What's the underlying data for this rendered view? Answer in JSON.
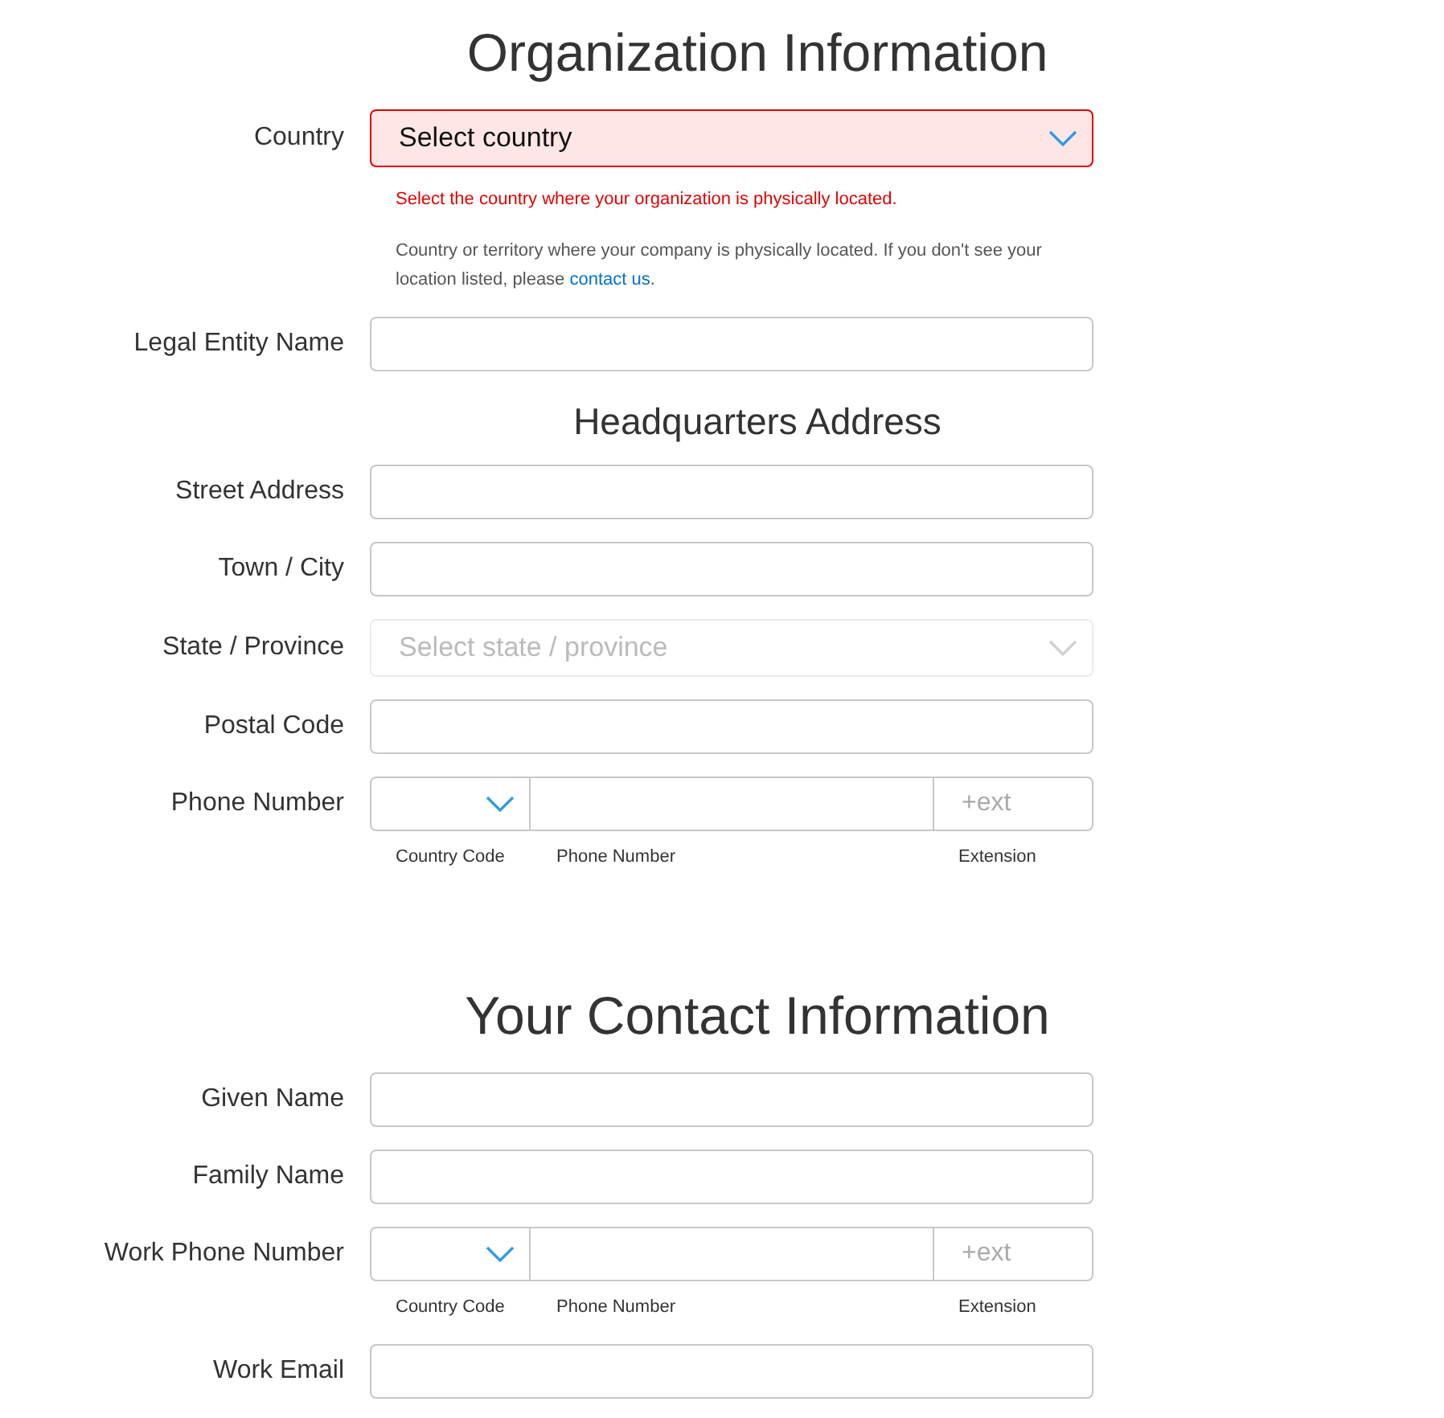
{
  "sections": [
    {
      "title": "Organization Information",
      "kind": "title",
      "fields": [
        {
          "kind": "select",
          "label": "Country",
          "placeholder": "Select country",
          "invalid": true,
          "disabled": false,
          "error": "Select the country where your organization is physically located.",
          "help_before": "Country or territory where your company is physically located. If you don't see your location listed, please ",
          "help_link": "contact us",
          "help_after": "."
        },
        {
          "kind": "text",
          "label": "Legal Entity Name"
        }
      ]
    },
    {
      "title": "Headquarters Address",
      "kind": "subtitle",
      "fields": [
        {
          "kind": "text",
          "label": "Street Address"
        },
        {
          "kind": "text",
          "label": "Town / City"
        },
        {
          "kind": "select",
          "label": "State / Province",
          "placeholder": "Select state / province",
          "invalid": false,
          "disabled": true
        },
        {
          "kind": "text",
          "label": "Postal Code"
        },
        {
          "kind": "phone",
          "label": "Phone Number",
          "ext_placeholder": "+ext",
          "captions": [
            "Country Code",
            "Phone Number",
            "Extension"
          ]
        }
      ]
    },
    {
      "title": "Your Contact Information",
      "kind": "title",
      "fields": [
        {
          "kind": "text",
          "label": "Given Name"
        },
        {
          "kind": "text",
          "label": "Family Name"
        },
        {
          "kind": "phone",
          "label": "Work Phone Number",
          "ext_placeholder": "+ext",
          "captions": [
            "Country Code",
            "Phone Number",
            "Extension"
          ]
        },
        {
          "kind": "text",
          "label": "Work Email"
        }
      ]
    }
  ]
}
